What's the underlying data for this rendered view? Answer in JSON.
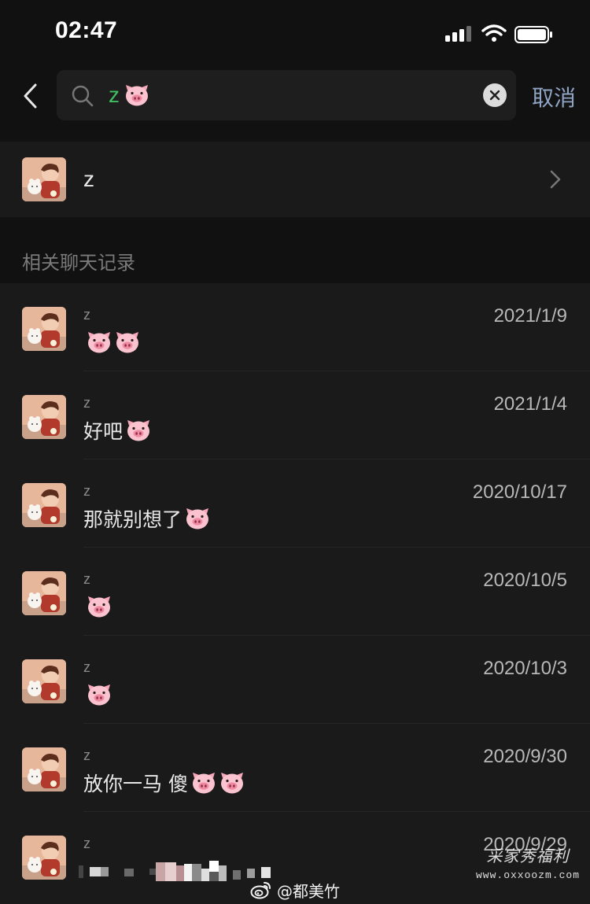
{
  "status_bar": {
    "time": "02:47"
  },
  "search": {
    "query_text": "z",
    "query_emoji": "pig-face",
    "cancel_label": "取消"
  },
  "contact": {
    "name": "z"
  },
  "section": {
    "title": "相关聊天记录"
  },
  "messages": [
    {
      "sender": "z",
      "date": "2021/1/9",
      "text": "",
      "pig_count": 2
    },
    {
      "sender": "z",
      "date": "2021/1/4",
      "text": "好吧",
      "pig_count": 1
    },
    {
      "sender": "z",
      "date": "2020/10/17",
      "text": "那就别想了",
      "pig_count": 1
    },
    {
      "sender": "z",
      "date": "2020/10/5",
      "text": "",
      "pig_count": 1
    },
    {
      "sender": "z",
      "date": "2020/10/3",
      "text": "",
      "pig_count": 1
    },
    {
      "sender": "z",
      "date": "2020/9/30",
      "text": "放你一马 傻",
      "pig_count": 2
    },
    {
      "sender": "z",
      "date": "2020/9/29",
      "text": "",
      "pig_count": 0
    }
  ],
  "watermarks": {
    "weibo_handle": "@都美竹",
    "site_title": "采家秀福利",
    "site_url": "www.oxxoozm.com"
  },
  "colors": {
    "background": "#111111",
    "panel": "#1a1a1a",
    "search_box": "#1e1e1e",
    "query_green": "#3fbf5f",
    "cancel_blue": "#8fa3c4"
  },
  "icons": [
    "back-arrow-icon",
    "search-icon",
    "clear-icon",
    "chevron-right-icon",
    "pig-face-emoji",
    "signal-icon",
    "wifi-icon",
    "battery-icon",
    "weibo-icon"
  ]
}
